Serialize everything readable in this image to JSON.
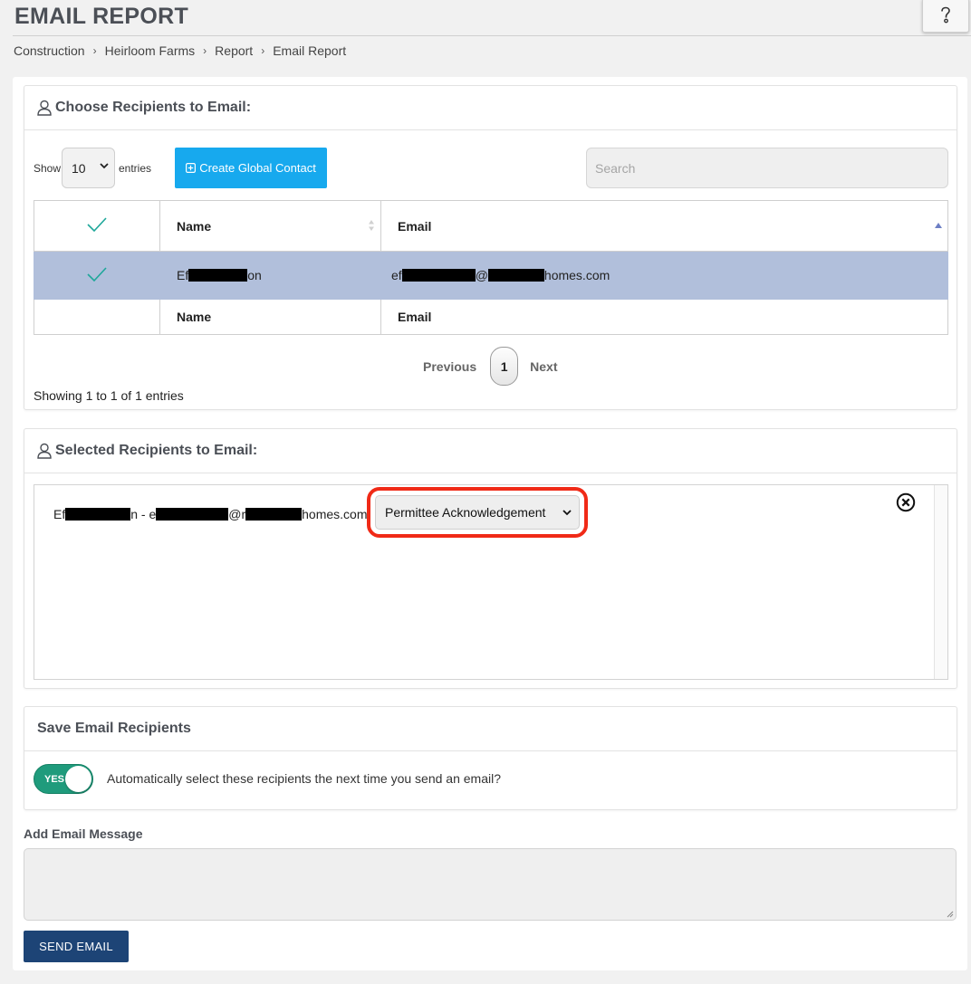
{
  "header": {
    "title": "EMAIL REPORT",
    "help_icon": "question-mark-icon"
  },
  "breadcrumb": [
    "Construction",
    "Heirloom Farms",
    "Report",
    "Email Report"
  ],
  "choose_panel": {
    "title": "Choose Recipients to Email:",
    "show_label": "Show",
    "entries_value": "10",
    "entries_label": "entries",
    "create_button": "Create Global Contact",
    "search_placeholder": "Search",
    "columns": {
      "name": "Name",
      "email": "Email"
    },
    "rows": [
      {
        "name_prefix": "Ef",
        "name_suffix": "on",
        "email_prefix": "ef",
        "email_mid": "@",
        "email_suffix": "homes.com",
        "selected": true
      }
    ],
    "pagination": {
      "previous": "Previous",
      "page": "1",
      "next": "Next"
    },
    "showing_text": "Showing 1 to 1 of 1 entries"
  },
  "selected_panel": {
    "title": "Selected Recipients to Email:",
    "recipient": {
      "prefix": "Ef",
      "mid1": "n - e",
      "mid2": "@r",
      "suffix": "homes.com"
    },
    "role_value": "Permittee Acknowledgement"
  },
  "save_panel": {
    "title": "Save Email Recipients",
    "toggle_label": "YES",
    "toggle_on": true,
    "auto_text": "Automatically select these recipients the next time you send an email?"
  },
  "message": {
    "label": "Add Email Message",
    "value": ""
  },
  "send_button": "SEND EMAIL",
  "colors": {
    "accent_blue": "#17a9ee",
    "send_navy": "#1d4476",
    "toggle_green": "#1f9b7c",
    "selected_row": "#b1bfdb",
    "highlight_red": "#f02a17",
    "check_teal": "#1ea79a"
  }
}
